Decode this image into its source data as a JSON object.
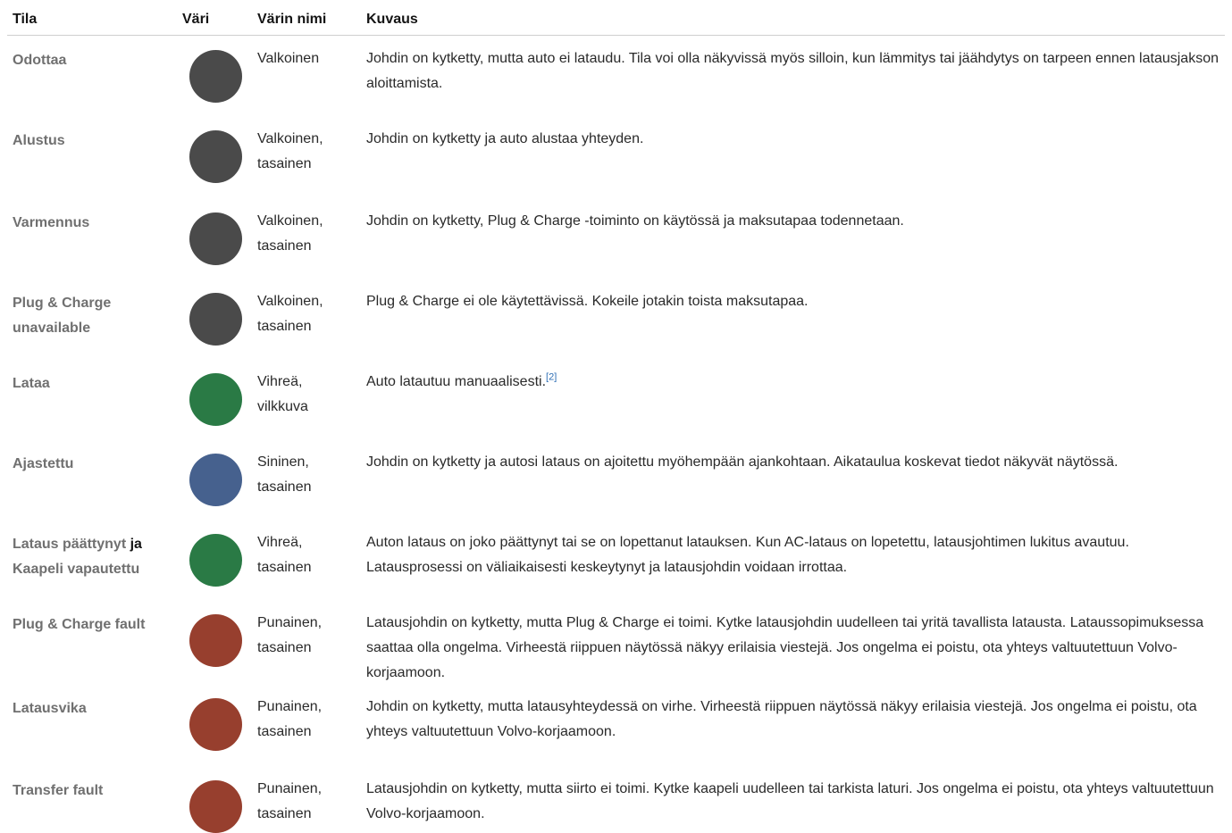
{
  "table": {
    "headers": [
      "Tila",
      "Väri",
      "Värin nimi",
      "Kuvaus"
    ],
    "rows": [
      {
        "state": "Odottaa",
        "color_name": "Valkoinen",
        "dot_color": "#4a4a4a",
        "description": "Johdin on kytketty, mutta auto ei lataudu. Tila voi olla näkyvissä myös silloin, kun lämmitys tai jäähdytys on tarpeen ennen latausjakson aloittamista."
      },
      {
        "state": "Alustus",
        "color_name": "Valkoinen, tasainen",
        "dot_color": "#4a4a4a",
        "description": "Johdin on kytketty ja auto alustaa yhteyden."
      },
      {
        "state": "Varmennus",
        "color_name": "Valkoinen, tasainen",
        "dot_color": "#4a4a4a",
        "description": "Johdin on kytketty, Plug & Charge -toiminto on käytössä ja maksutapaa todennetaan."
      },
      {
        "state": "Plug & Charge unavailable",
        "color_name": "Valkoinen, tasainen",
        "dot_color": "#4a4a4a",
        "description": "Plug & Charge ei ole käytettävissä. Kokeile jotakin toista maksutapaa."
      },
      {
        "state": "Lataa",
        "color_name": "Vihreä, vilkkuva",
        "dot_color": "#2a7a45",
        "description": "Auto latautuu manuaalisesti.",
        "reference": "[2]"
      },
      {
        "state": "Ajastettu",
        "color_name": "Sininen, tasainen",
        "dot_color": "#46618e",
        "description": "Johdin on kytketty ja autosi lataus on ajoitettu myöhempään ajankohtaan. Aikataulua koskevat tiedot näkyvät näytössä."
      },
      {
        "state_part1": "Lataus päättynyt",
        "state_joiner": "ja",
        "state_part2": "Kaapeli vapautettu",
        "color_name": "Vihreä, tasainen",
        "dot_color": "#2a7a45",
        "description": "Auton lataus on joko päättynyt tai se on lopettanut latauksen. Kun AC-lataus on lopetettu, latausjohtimen lukitus avautuu. Latausprosessi on väliaikaisesti keskeytynyt ja latausjohdin voidaan irrottaa."
      },
      {
        "state": "Plug & Charge fault",
        "color_name": "Punainen, tasainen",
        "dot_color": "#973f2e",
        "description": "Latausjohdin on kytketty, mutta Plug & Charge ei toimi. Kytke latausjohdin uudelleen tai yritä tavallista latausta. Lataussopimuksessa saattaa olla ongelma. Virheestä riippuen näytössä näkyy erilaisia viestejä. Jos ongelma ei poistu, ota yhteys valtuutettuun Volvo-korjaamoon."
      },
      {
        "state": "Latausvika",
        "color_name": "Punainen, tasainen",
        "dot_color": "#973f2e",
        "description": "Johdin on kytketty, mutta latausyhteydessä on virhe. Virheestä riippuen näytössä näkyy erilaisia viestejä. Jos ongelma ei poistu, ota yhteys valtuutettuun Volvo-korjaamoon."
      },
      {
        "state": "Transfer fault",
        "color_name": "Punainen, tasainen",
        "dot_color": "#973f2e",
        "description": "Latausjohdin on kytketty, mutta siirto ei toimi. Kytke kaapeli uudelleen tai tarkista laturi. Jos ongelma ei poistu, ota yhteys valtuutettuun Volvo-korjaamoon."
      }
    ]
  }
}
